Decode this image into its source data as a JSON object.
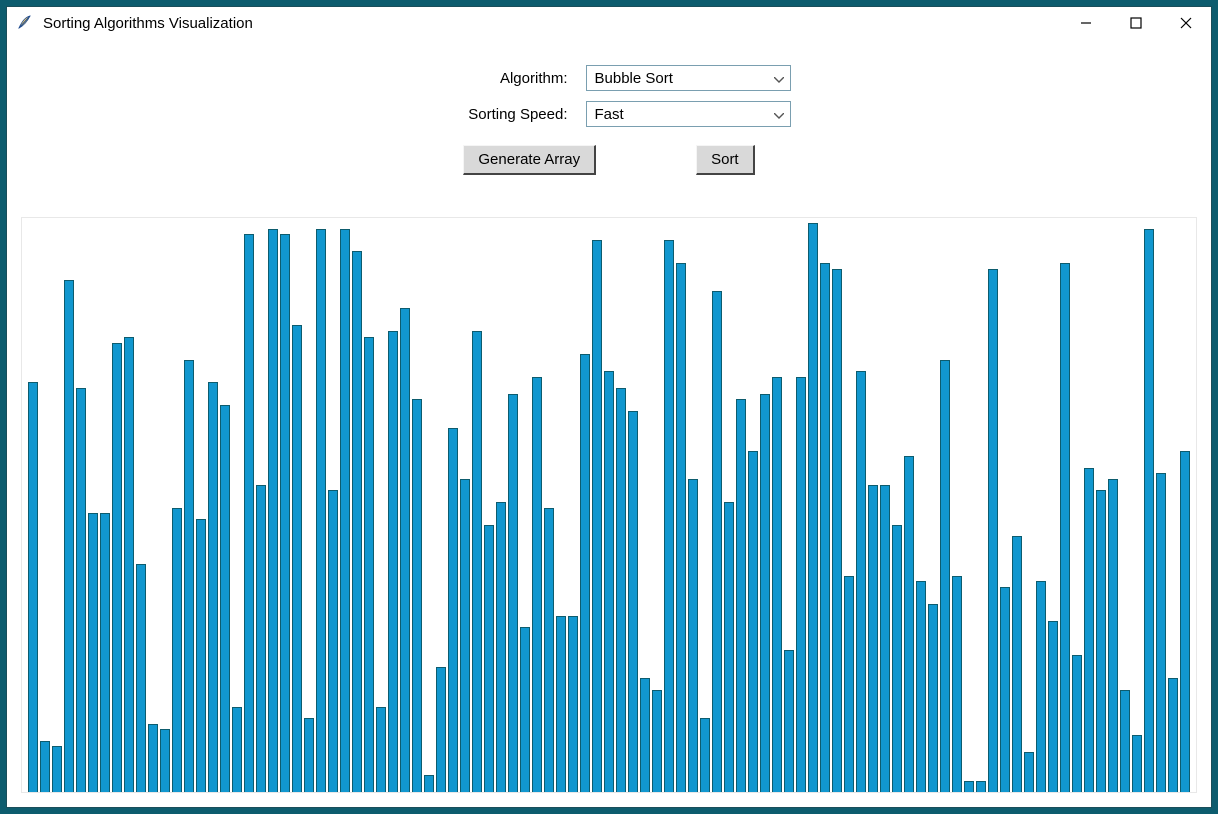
{
  "window": {
    "title": "Sorting Algorithms Visualization"
  },
  "controls": {
    "algorithm_label": "Algorithm:",
    "algorithm_value": "Bubble Sort",
    "speed_label": "Sorting Speed:",
    "speed_value": "Fast",
    "generate_button": "Generate Array",
    "sort_button": "Sort"
  },
  "chart_data": {
    "type": "bar",
    "title": "",
    "xlabel": "",
    "ylabel": "",
    "ylim": [
      0,
      100
    ],
    "values": [
      72,
      9,
      8,
      90,
      71,
      49,
      49,
      79,
      80,
      40,
      12,
      11,
      50,
      76,
      48,
      72,
      68,
      15,
      98,
      54,
      99,
      98,
      82,
      13,
      99,
      53,
      99,
      95,
      80,
      15,
      81,
      85,
      69,
      3,
      22,
      64,
      55,
      81,
      47,
      51,
      70,
      29,
      73,
      50,
      31,
      31,
      77,
      97,
      74,
      71,
      67,
      20,
      18,
      97,
      93,
      55,
      13,
      88,
      51,
      69,
      60,
      70,
      73,
      25,
      73,
      100,
      93,
      92,
      38,
      74,
      54,
      54,
      47,
      59,
      37,
      33,
      76,
      38,
      2,
      2,
      92,
      36,
      45,
      7,
      37,
      30,
      93,
      24,
      57,
      53,
      55,
      18,
      10,
      99,
      56,
      20,
      60
    ]
  }
}
